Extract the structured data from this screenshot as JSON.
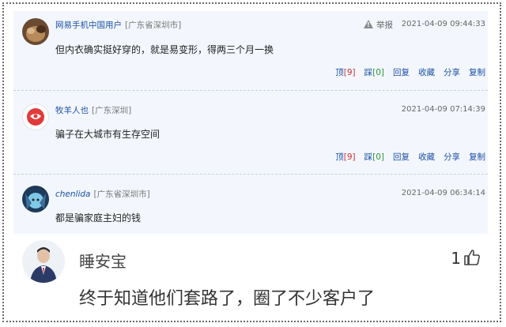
{
  "comments": [
    {
      "username": "网易手机中国用户",
      "location": "[广东省深圳市]",
      "report_label": "举报",
      "timestamp": "2021-04-09 09:44:33",
      "text": "但内衣确实挺好穿的，就是易变形，得两三个月一换",
      "actions": {
        "up_label": "顶",
        "up_count": "[9]",
        "down_label": "踩",
        "down_count": "[0]",
        "reply": "回复",
        "collect": "收藏",
        "share": "分享",
        "copy": "复制"
      }
    },
    {
      "username": "牧羊人也",
      "location": "[广东深圳]",
      "timestamp": "2021-04-09 07:14:39",
      "text": "骗子在大城市有生存空间",
      "actions": {
        "up_label": "顶",
        "up_count": "[9]",
        "down_label": "踩",
        "down_count": "[0]",
        "reply": "回复",
        "collect": "收藏",
        "share": "分享",
        "copy": "复制"
      }
    },
    {
      "username": "chenlida",
      "location": "[广东省深圳市]",
      "timestamp": "2021-04-09 06:34:14",
      "text": "都是骗家庭主妇的钱"
    }
  ],
  "wechat_comment": {
    "username": "睡安宝",
    "like_count": "1",
    "text": "终于知道他们套路了，圈了不少客户了"
  },
  "colors": {
    "link": "#1d4fa7",
    "up": "#c33",
    "down": "#2a9a3a",
    "feed_bg": "#f3f7fd"
  },
  "icons": [
    "warning-icon",
    "thumbs-up-icon"
  ]
}
